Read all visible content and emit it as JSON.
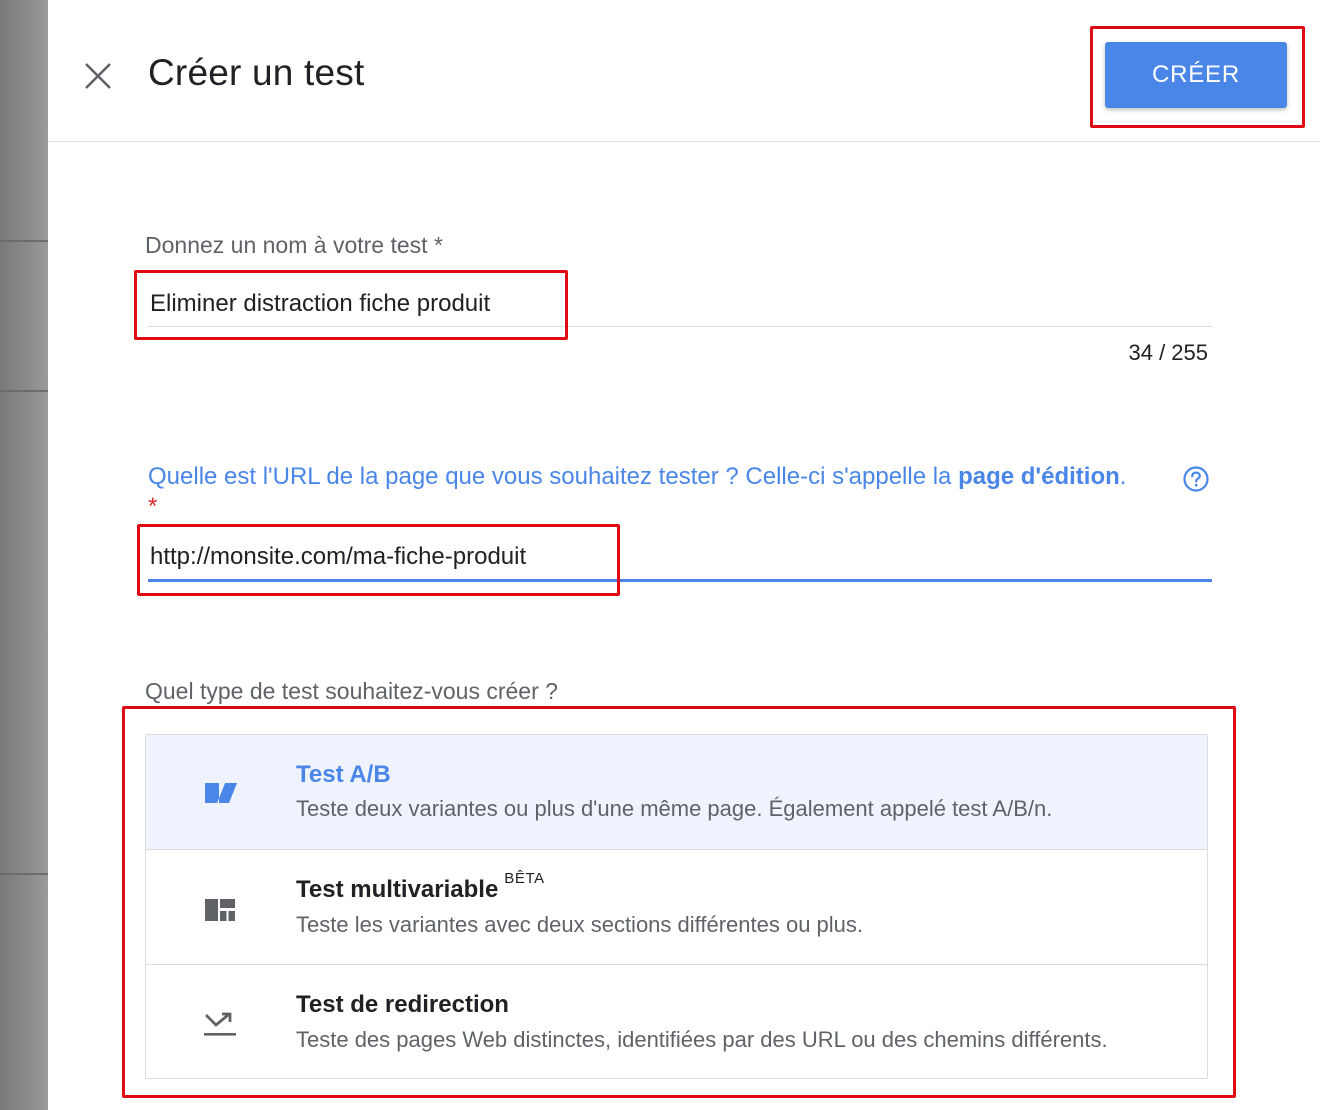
{
  "header": {
    "title": "Créer un test",
    "create_label": "CRÉER"
  },
  "name_field": {
    "label": "Donnez un nom à votre test *",
    "value": "Eliminer distraction fiche produit",
    "counter": "34 / 255"
  },
  "url_field": {
    "label_part1": "Quelle est l'URL de la page que vous souhaitez tester ? Celle-ci s'appelle la ",
    "label_bold": "page d'édition",
    "label_part2": ".",
    "required_mark": "*",
    "value": "http://monsite.com/ma-fiche-produit"
  },
  "test_type": {
    "label": "Quel type de test souhaitez-vous créer ?",
    "options": [
      {
        "title": "Test A/B",
        "badge": "",
        "description": "Teste deux variantes ou plus d'une même page. Également appelé test A/B/n.",
        "icon": "ab-test-icon",
        "selected": true
      },
      {
        "title": "Test multivariable",
        "badge": "BÊTA",
        "description": "Teste les variantes avec deux sections différentes ou plus.",
        "icon": "multivariate-icon",
        "selected": false
      },
      {
        "title": "Test de redirection",
        "badge": "",
        "description": "Teste des pages Web distinctes, identifiées par des URL ou des chemins différents.",
        "icon": "redirect-icon",
        "selected": false
      }
    ]
  },
  "colors": {
    "accent": "#4a86e8",
    "highlight": "#e00a14",
    "required": "#d93025",
    "selected_bg": "#eef3fd"
  }
}
